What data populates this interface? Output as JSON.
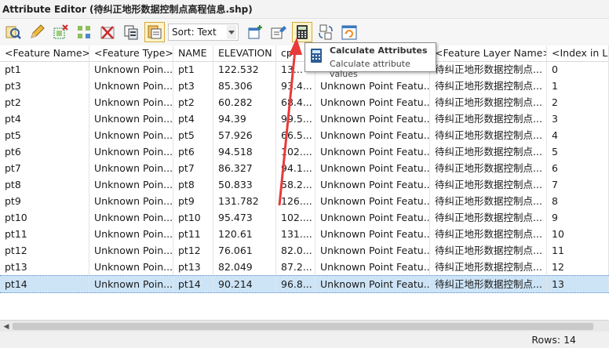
{
  "window": {
    "title": "Attribute Editor (待纠正地形数据控制点高程信息.shp)"
  },
  "toolbar": {
    "sort_label": "Sort: Text",
    "buttons": [
      "search-records-icon",
      "edit-pencil-icon",
      "select-grid-icon",
      "move-records-icon",
      "delete-records-icon",
      "copy-records-icon",
      "sort-icon"
    ]
  },
  "tooltip": {
    "title": "Calculate Attributes",
    "description": "Calculate attribute values"
  },
  "table": {
    "columns": [
      "<Feature Name>",
      "<Feature Type>",
      "NAME",
      "ELEVATION",
      "cp",
      "",
      "<Feature Layer Name>",
      "<Index in Lay"
    ],
    "rows": [
      [
        "pt1",
        "Unknown Poin...",
        "pt1",
        "122.532",
        "13...",
        "",
        "待纠正地形数据控制点...",
        "0"
      ],
      [
        "pt3",
        "Unknown Poin...",
        "pt3",
        "85.306",
        "93.4...",
        "Unknown Point Featu...",
        "待纠正地形数据控制点...",
        "1"
      ],
      [
        "pt2",
        "Unknown Poin...",
        "pt2",
        "60.282",
        "68.4...",
        "Unknown Point Featu...",
        "待纠正地形数据控制点...",
        "2"
      ],
      [
        "pt4",
        "Unknown Poin...",
        "pt4",
        "94.39",
        "99.5...",
        "Unknown Point Featu...",
        "待纠正地形数据控制点...",
        "3"
      ],
      [
        "pt5",
        "Unknown Poin...",
        "pt5",
        "57.926",
        "66.5...",
        "Unknown Point Featu...",
        "待纠正地形数据控制点...",
        "4"
      ],
      [
        "pt6",
        "Unknown Poin...",
        "pt6",
        "94.518",
        "102....",
        "Unknown Point Featu...",
        "待纠正地形数据控制点...",
        "5"
      ],
      [
        "pt7",
        "Unknown Poin...",
        "pt7",
        "86.327",
        "94.1...",
        "Unknown Point Featu...",
        "待纠正地形数据控制点...",
        "6"
      ],
      [
        "pt8",
        "Unknown Poin...",
        "pt8",
        "50.833",
        "58.2...",
        "Unknown Point Featu...",
        "待纠正地形数据控制点...",
        "7"
      ],
      [
        "pt9",
        "Unknown Poin...",
        "pt9",
        "131.782",
        "126....",
        "Unknown Point Featu...",
        "待纠正地形数据控制点...",
        "8"
      ],
      [
        "pt10",
        "Unknown Poin...",
        "pt10",
        "95.473",
        "102....",
        "Unknown Point Featu...",
        "待纠正地形数据控制点...",
        "9"
      ],
      [
        "pt11",
        "Unknown Poin...",
        "pt11",
        "120.61",
        "131....",
        "Unknown Point Featu...",
        "待纠正地形数据控制点...",
        "10"
      ],
      [
        "pt12",
        "Unknown Poin...",
        "pt12",
        "76.061",
        "82.0...",
        "Unknown Point Featu...",
        "待纠正地形数据控制点...",
        "11"
      ],
      [
        "pt13",
        "Unknown Poin...",
        "pt13",
        "82.049",
        "87.2...",
        "Unknown Point Featu...",
        "待纠正地形数据控制点...",
        "12"
      ],
      [
        "pt14",
        "Unknown Poin...",
        "pt14",
        "90.214",
        "96.8...",
        "Unknown Point Featu...",
        "待纠正地形数据控制点...",
        "13"
      ]
    ],
    "selected_row": 13
  },
  "status": {
    "rows_label": "Rows: 14"
  },
  "colors": {
    "selection": "#cde4f7",
    "accent_arrow": "#e83a3a",
    "active_button": "#fff3c8"
  }
}
